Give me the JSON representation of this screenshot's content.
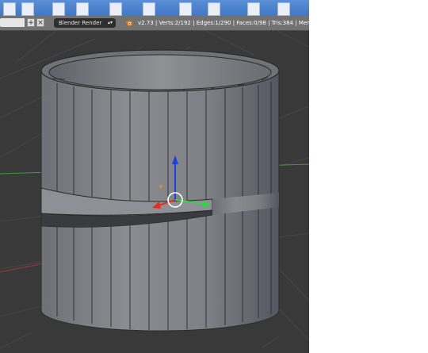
{
  "header": {
    "add_icon": "plus-icon",
    "close_icon": "x-icon",
    "render_engine": "Blender Render",
    "stats": "v2.73 | Verts:2/192 | Edges:1/290 | Faces:0/98 | Tris:384 | Mem"
  },
  "viewport": {
    "object": "cylinder-mesh",
    "gizmo": "translate-manipulator",
    "axis_colors": {
      "x": "#e3301c",
      "y": "#35d34a",
      "z": "#1c3fe0"
    },
    "background": "#393939",
    "grid_color": "#474747",
    "mesh_color": "#7a7c82"
  }
}
